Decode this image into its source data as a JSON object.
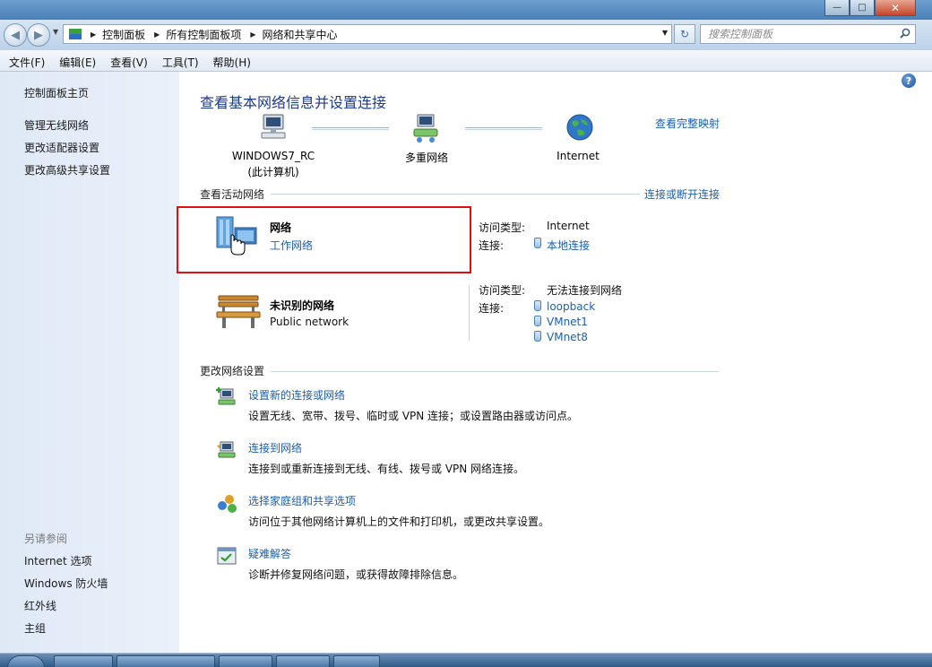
{
  "window": {
    "controls": {
      "minimize": "—",
      "maximize": "□",
      "close": "✕"
    }
  },
  "address": {
    "breadcrumbs": [
      "控制面板",
      "所有控制面板项",
      "网络和共享中心"
    ],
    "search_placeholder": "搜索控制面板"
  },
  "menu": [
    "文件(F)",
    "编辑(E)",
    "查看(V)",
    "工具(T)",
    "帮助(H)"
  ],
  "sidebar": {
    "links": [
      "控制面板主页",
      "管理无线网络",
      "更改适配器设置",
      "更改高级共享设置"
    ],
    "see_also_header": "另请参阅",
    "see_also": [
      "Internet 选项",
      "Windows 防火墙",
      "红外线",
      "主组"
    ]
  },
  "main": {
    "title": "查看基本网络信息并设置连接",
    "full_map_link": "查看完整映射",
    "map": {
      "computer_name": "WINDOWS7_RC",
      "computer_sub": "(此计算机)",
      "middle": "多重网络",
      "internet": "Internet"
    },
    "active_header": "查看活动网络",
    "connect_link": "连接或断开连接",
    "networks": [
      {
        "name": "网络",
        "type": "工作网络",
        "access_label": "访问类型:",
        "access_value": "Internet",
        "conn_label": "连接:",
        "connections": [
          "本地连接"
        ]
      },
      {
        "name": "未识别的网络",
        "type": "Public network",
        "access_label": "访问类型:",
        "access_value": "无法连接到网络",
        "conn_label": "连接:",
        "connections": [
          "loopback",
          "VMnet1",
          "VMnet8"
        ]
      }
    ],
    "change_header": "更改网络设置",
    "tasks": [
      {
        "link": "设置新的连接或网络",
        "desc": "设置无线、宽带、拨号、临时或 VPN 连接；或设置路由器或访问点。"
      },
      {
        "link": "连接到网络",
        "desc": "连接到或重新连接到无线、有线、拨号或 VPN 网络连接。"
      },
      {
        "link": "选择家庭组和共享选项",
        "desc": "访问位于其他网络计算机上的文件和打印机，或更改共享设置。"
      },
      {
        "link": "疑难解答",
        "desc": "诊断并修复网络问题，或获得故障排除信息。"
      }
    ]
  },
  "icons": {
    "help": "?",
    "refresh": "↻",
    "back": "◀",
    "forward": "▶"
  },
  "colors": {
    "link": "#1a5fb4",
    "title": "#1e3a8a",
    "highlight": "#e01010"
  }
}
